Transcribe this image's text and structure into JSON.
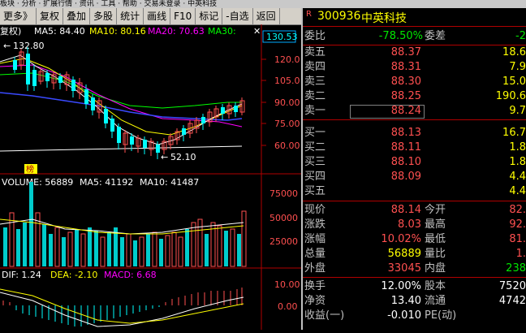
{
  "top_menu": "板块 · 分析 · 扩展行情 · 资讯 · 工具 · 帮助 · 交易未登录 · 中英科技",
  "toolbar": {
    "more": "更多》",
    "items": [
      "复权",
      "叠加",
      "多股",
      "统计",
      "画线",
      "F10",
      "标记",
      "-自选",
      "返回"
    ]
  },
  "main_chart": {
    "mode_label": "复权)",
    "ma5": "MA5: 84.40",
    "ma10": "MA10: 80.16",
    "ma20": "MA20: 70.63",
    "ma30": "MA30:",
    "current_price_tag": "130.53",
    "high_label": "132.80",
    "low_label": "52.10",
    "badge": "榜",
    "y_ticks": [
      "120.0",
      "105.0",
      "90.00",
      "75.00",
      "60.00"
    ]
  },
  "volume_chart": {
    "label": "VOLUME: 56889",
    "ma5": "MA5: 41192",
    "ma10": "MA10: 41487",
    "y_ticks": [
      "75000",
      "50000",
      "25000"
    ]
  },
  "macd_chart": {
    "dif": "DIF: 1.24",
    "dea": "DEA: -2.10",
    "macd": "MACD: 6.68",
    "y_ticks": [
      "10.00",
      "0.00"
    ]
  },
  "quote": {
    "code": "300936",
    "name": "中英科技",
    "weibi_label": "委比",
    "weibi_value": "-78.50%",
    "weicha_label": "委差",
    "weicha_value": "-2",
    "sell": [
      {
        "label": "卖五",
        "price": "88.37",
        "vol": "18.6"
      },
      {
        "label": "卖四",
        "price": "88.31",
        "vol": "7.9"
      },
      {
        "label": "卖三",
        "price": "88.30",
        "vol": "15.0"
      },
      {
        "label": "卖二",
        "price": "88.25",
        "vol": "190.6"
      },
      {
        "label": "卖一",
        "price": "88.24",
        "vol": "9.7"
      }
    ],
    "buy": [
      {
        "label": "买一",
        "price": "88.13",
        "vol": "16.7"
      },
      {
        "label": "买二",
        "price": "88.11",
        "vol": "1.8"
      },
      {
        "label": "买三",
        "price": "88.10",
        "vol": "1.8"
      },
      {
        "label": "买四",
        "price": "88.09",
        "vol": "4.4"
      },
      {
        "label": "买五",
        "price": "",
        "vol": "4.4"
      }
    ],
    "stats": [
      {
        "l1": "现价",
        "v1": "88.14",
        "l2": "今开",
        "v2": "82."
      },
      {
        "l1": "涨跌",
        "v1": "8.03",
        "l2": "最高",
        "v2": "92."
      },
      {
        "l1": "涨幅",
        "v1": "10.02%",
        "l2": "最低",
        "v2": "81."
      },
      {
        "l1": "总量",
        "v1": "56889",
        "l2": "量比",
        "v2": "1."
      },
      {
        "l1": "外盘",
        "v1": "33045",
        "l2": "内盘",
        "v2": "238"
      }
    ],
    "stats2": [
      {
        "l1": "换手",
        "v1": "12.00%",
        "l2": "股本",
        "v2": "7520"
      },
      {
        "l1": "净资",
        "v1": "13.40",
        "l2": "流通",
        "v2": "4742"
      },
      {
        "l1": "收益(一)",
        "v1": "-0.010",
        "l2": "PE(动)",
        "v2": ""
      }
    ]
  },
  "colors": {
    "up": "#ff5050",
    "down": "#00ffff",
    "ma5": "#ffffff",
    "ma10": "#ffff00",
    "ma20": "#ff00ff",
    "ma30": "#00ff00"
  }
}
